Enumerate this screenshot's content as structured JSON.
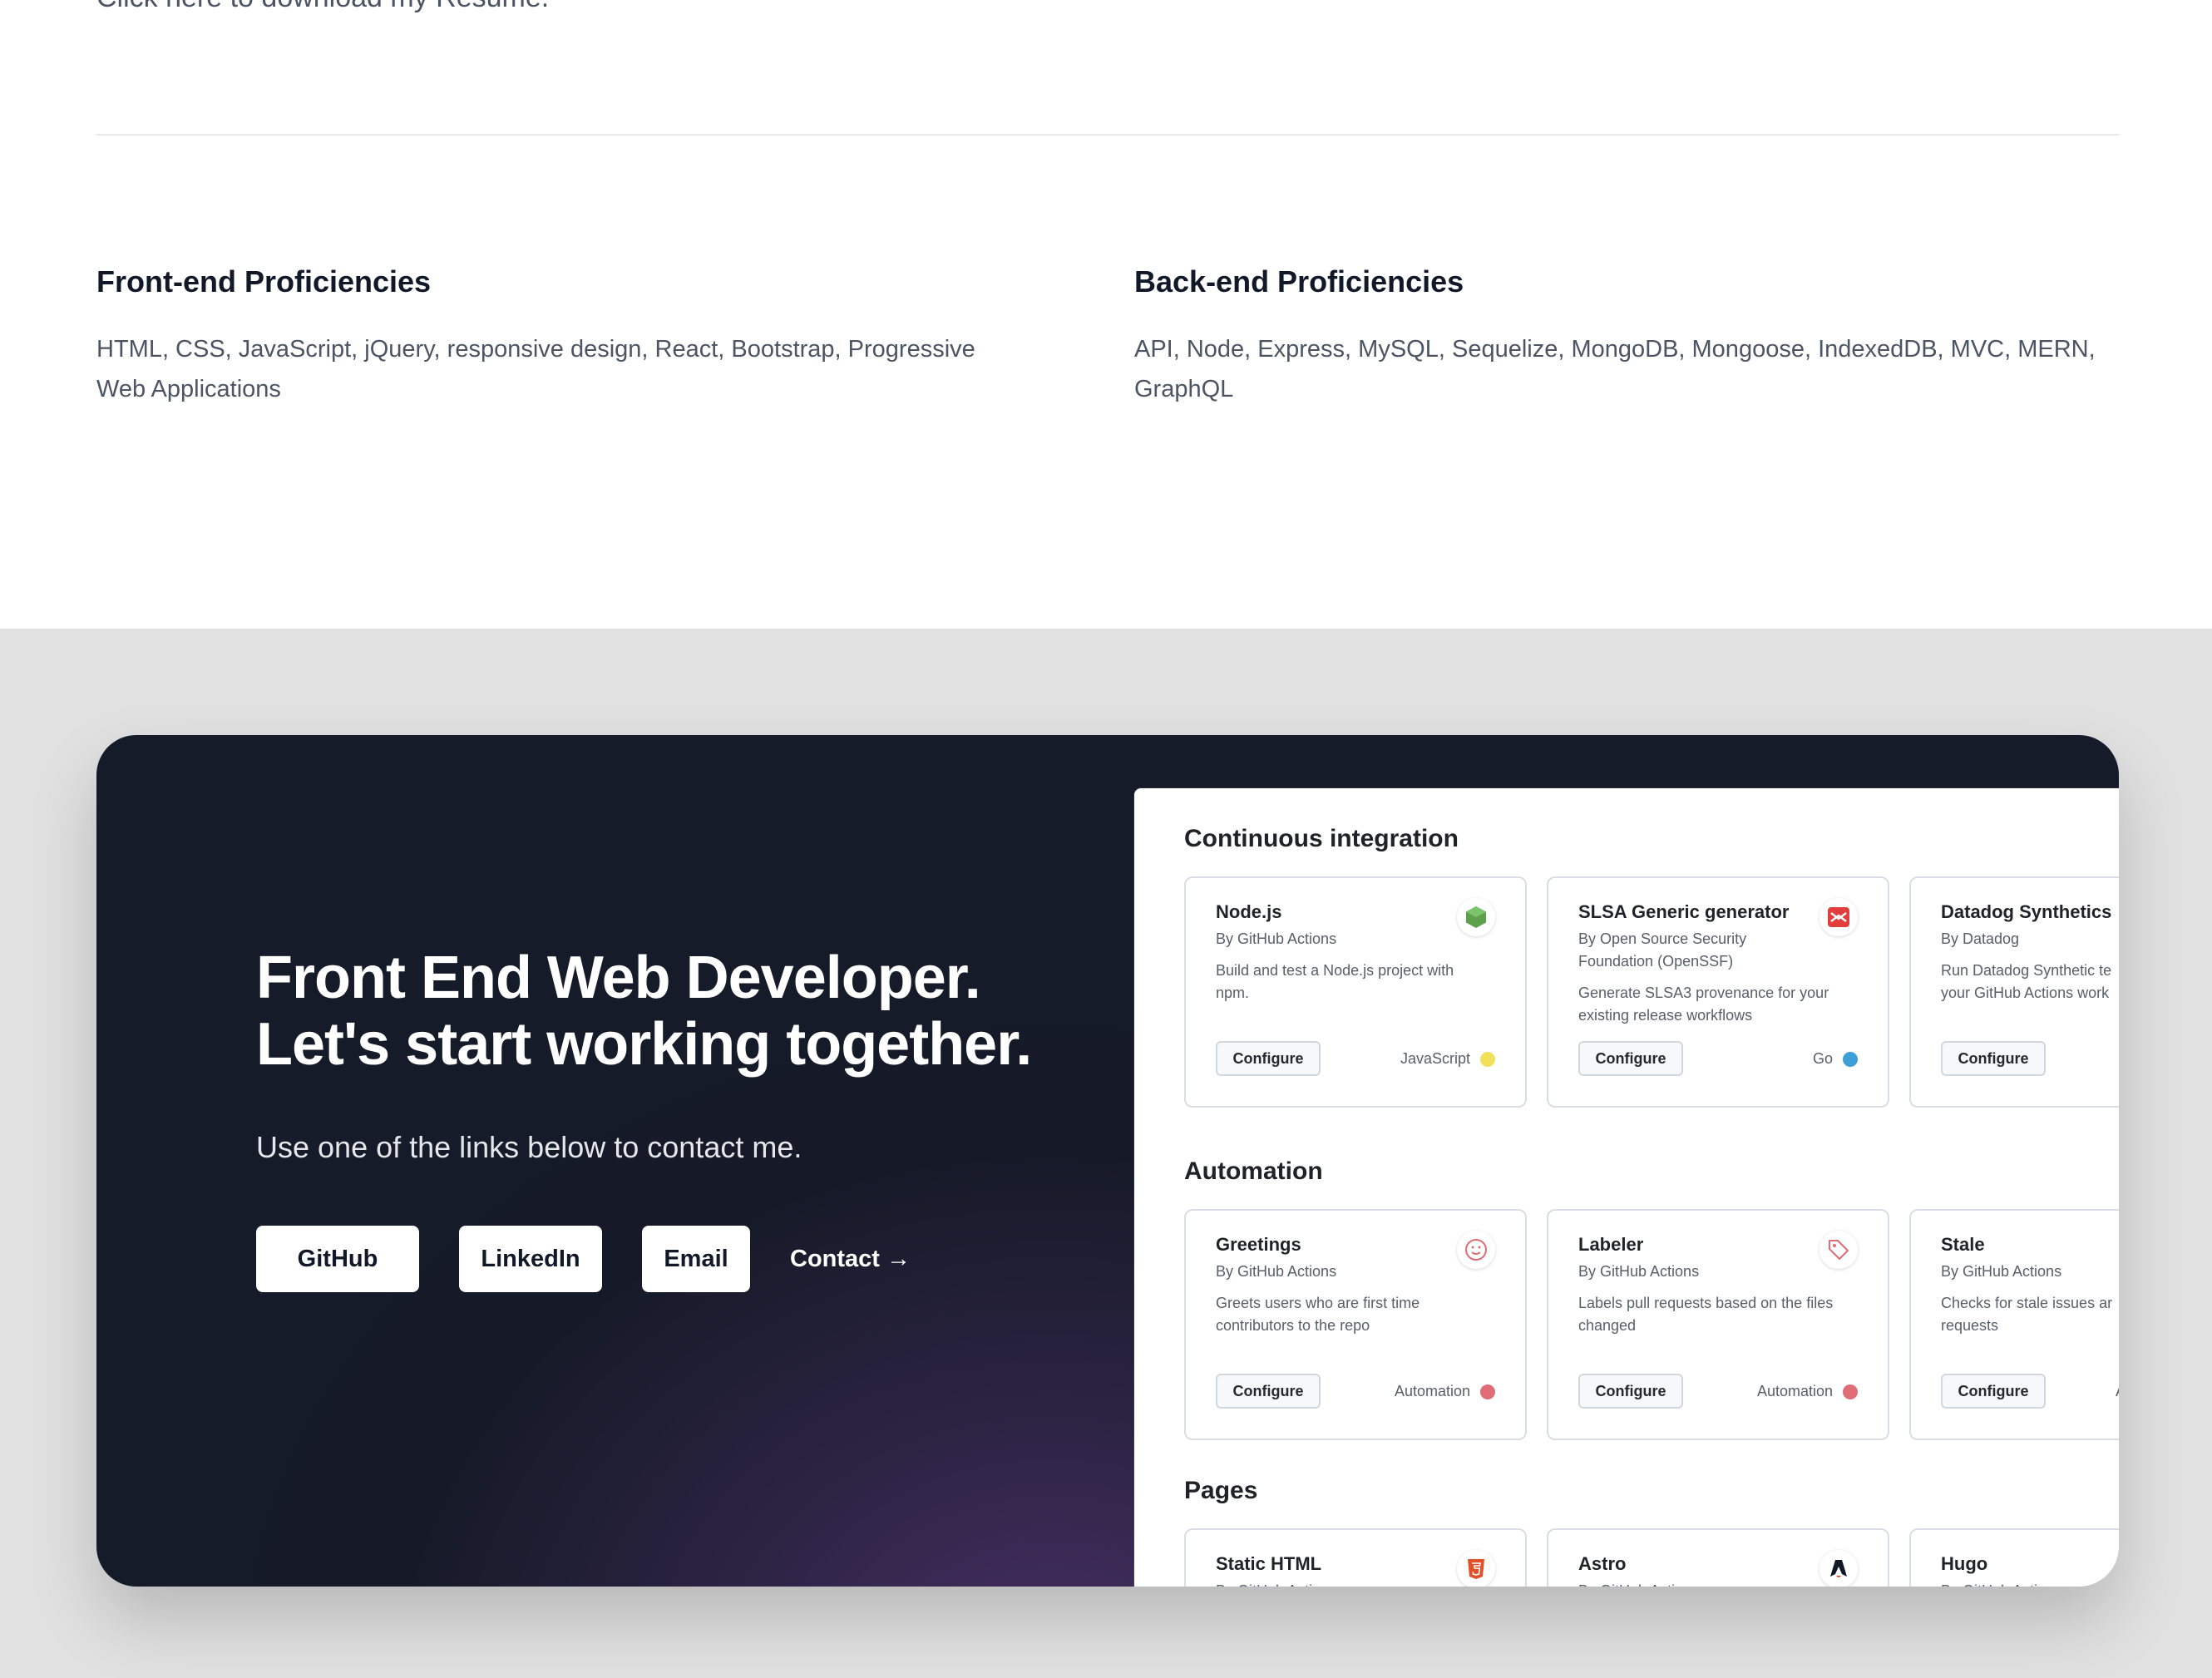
{
  "resume": {
    "link_text": "Click here to download my Resume."
  },
  "frontend": {
    "heading": "Front-end Proficiencies",
    "text": "HTML, CSS, JavaScript, jQuery, responsive design, React, Bootstrap, Progressive Web Applications"
  },
  "backend": {
    "heading": "Back-end Proficiencies",
    "text": "API, Node, Express, MySQL, Sequelize, MongoDB, Mongoose, IndexedDB, MVC, MERN, GraphQL"
  },
  "cta": {
    "title": "Front End Web Developer. Let's start working together.",
    "subtitle": "Use one of the links below to contact me.",
    "buttons": {
      "github": "GitHub",
      "linkedin": "LinkedIn",
      "email": "Email",
      "contact": "Contact →"
    }
  },
  "screenshot": {
    "sections": [
      {
        "title": "Continuous integration",
        "cards": [
          {
            "name": "Node.js",
            "by": "By GitHub Actions",
            "desc": "Build and test a Node.js project with npm.",
            "button": "Configure",
            "lang": "JavaScript",
            "lang_color": "#f1e05a",
            "icon": "nodejs-hex-icon",
            "icon_color": "#5fa04e"
          },
          {
            "name": "SLSA Generic generator",
            "by": "By Open Source Security Foundation (OpenSSF)",
            "desc": "Generate SLSA3 provenance for your existing release workflows",
            "button": "Configure",
            "lang": "Go",
            "lang_color": "#00add8",
            "icon": "slsa-icon",
            "icon_color": "#e23e3e"
          },
          {
            "name": "Datadog Synthetics",
            "by": "By Datadog",
            "desc": "Run Datadog Synthetic te your GitHub Actions work",
            "button": "Configure",
            "lang": "",
            "lang_color": "",
            "icon": "",
            "icon_color": ""
          }
        ]
      },
      {
        "title": "Automation",
        "cards": [
          {
            "name": "Greetings",
            "by": "By GitHub Actions",
            "desc": "Greets users who are first time contributors to the repo",
            "button": "Configure",
            "lang": "Automation",
            "lang_color": "#e06c75",
            "icon": "smiley-icon",
            "icon_color": "#e06c75"
          },
          {
            "name": "Labeler",
            "by": "By GitHub Actions",
            "desc": "Labels pull requests based on the files changed",
            "button": "Configure",
            "lang": "Automation",
            "lang_color": "#e06c75",
            "icon": "tag-icon",
            "icon_color": "#e06c75"
          },
          {
            "name": "Stale",
            "by": "By GitHub Actions",
            "desc": "Checks for stale issues ar requests",
            "button": "Configure",
            "lang": "A",
            "lang_color": "",
            "icon": "",
            "icon_color": ""
          }
        ]
      },
      {
        "title": "Pages",
        "cards": [
          {
            "name": "Static HTML",
            "by": "By GitHub Actions",
            "icon": "html5-icon",
            "icon_color": "#e34f26"
          },
          {
            "name": "Astro",
            "by": "By GitHub Actions",
            "icon": "astro-icon",
            "icon_color": "#111827"
          },
          {
            "name": "Hugo",
            "by": "By GitHub Actions",
            "icon": "",
            "icon_color": ""
          }
        ]
      }
    ]
  }
}
